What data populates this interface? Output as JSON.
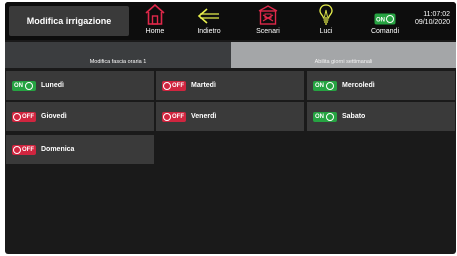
{
  "header": {
    "title": "Modifica irrigazione",
    "nav": [
      {
        "label": "Home",
        "icon": "home-icon",
        "color": "#e0284a"
      },
      {
        "label": "Indietro",
        "icon": "back-arrow-icon",
        "color": "#e6ee4c"
      },
      {
        "label": "Scenari",
        "icon": "scenarios-icon",
        "color": "#e0284a"
      },
      {
        "label": "Luci",
        "icon": "lightbulb-icon",
        "color": "#e6ee4c"
      },
      {
        "label": "Comandi",
        "icon": "toggle-icon",
        "color": "#26a342",
        "badge": "ON"
      }
    ],
    "time": "11:07:02",
    "date": "09/10/2020"
  },
  "tabs": [
    {
      "label": "Modifica fascia oraria 1",
      "active": false
    },
    {
      "label": "Abilita giorni settimanali",
      "active": true
    }
  ],
  "days": [
    {
      "label": "Lunedì",
      "state": "ON"
    },
    {
      "label": "Martedì",
      "state": "OFF"
    },
    {
      "label": "Mercoledì",
      "state": "ON"
    },
    {
      "label": "Giovedì",
      "state": "OFF"
    },
    {
      "label": "Venerdì",
      "state": "OFF"
    },
    {
      "label": "Sabato",
      "state": "ON"
    },
    {
      "label": "Domenica",
      "state": "OFF"
    }
  ],
  "colors": {
    "on": "#26a342",
    "off": "#d0253f",
    "accent_red": "#e0284a",
    "accent_yellow": "#e6ee4c"
  }
}
